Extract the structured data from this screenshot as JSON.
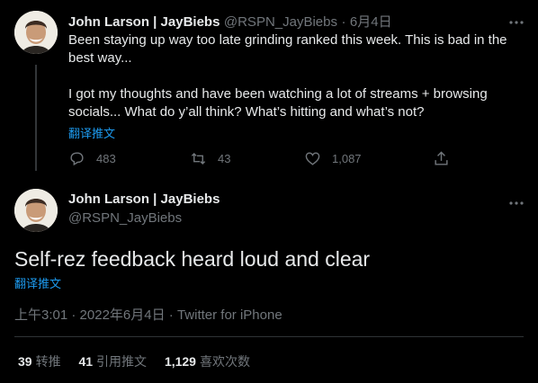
{
  "tweet1": {
    "author_name": "John Larson | JayBiebs",
    "author_handle": "@RSPN_JayBiebs",
    "separator": "·",
    "date": "6月4日",
    "text_line1": "Been staying up way too late grinding ranked this week. This is bad in the",
    "text_line2": "best way...",
    "text_line3": "I got my thoughts and have been watching a lot of streams + browsing",
    "text_line4": "socials... What do y’all think? What’s hitting and what’s not?",
    "translate": "翻译推文",
    "replies": "483",
    "retweets": "43",
    "likes": "1,087"
  },
  "tweet2": {
    "author_name": "John Larson | JayBiebs",
    "author_handle": "@RSPN_JayBiebs",
    "text": "Self-rez feedback heard loud and clear",
    "translate": "翻译推文",
    "time": "上午3:01",
    "separator1": "·",
    "date": "2022年6月4日",
    "separator2": "·",
    "source": "Twitter for iPhone",
    "stats": {
      "retweets_count": "39",
      "retweets_label": "转推",
      "quotes_count": "41",
      "quotes_label": "引用推文",
      "likes_count": "1,129",
      "likes_label": "喜欢次数"
    }
  },
  "icons": {
    "more": "more-icon",
    "reply": "reply-icon",
    "retweet": "retweet-icon",
    "like": "heart-icon",
    "share": "share-icon"
  }
}
